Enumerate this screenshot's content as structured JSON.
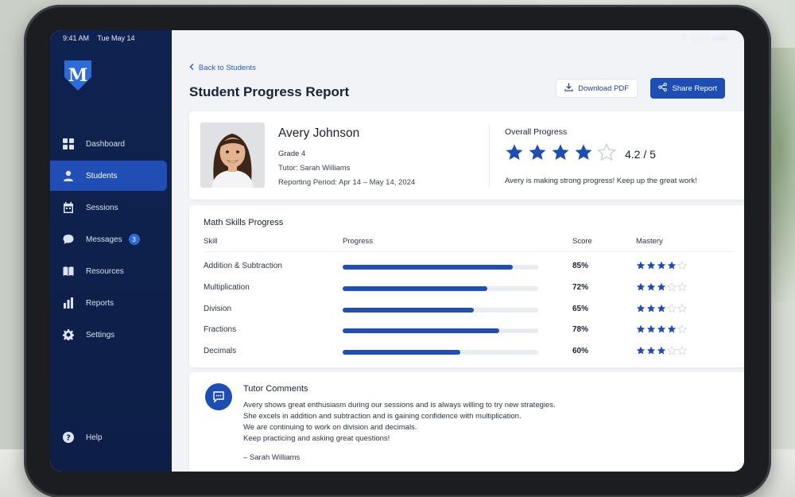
{
  "status": {
    "time": "9:41 AM",
    "date": "Tue May 14",
    "battery": "100%"
  },
  "sidebar": {
    "logo_letter": "M",
    "items": [
      {
        "label": "Dashboard",
        "icon": "grid-icon"
      },
      {
        "label": "Students",
        "icon": "person-icon",
        "active": true
      },
      {
        "label": "Sessions",
        "icon": "calendar-icon"
      },
      {
        "label": "Messages",
        "icon": "chat-icon",
        "badge": "3"
      },
      {
        "label": "Resources",
        "icon": "book-icon"
      },
      {
        "label": "Reports",
        "icon": "bar-chart-icon"
      },
      {
        "label": "Settings",
        "icon": "gear-icon"
      }
    ],
    "help_label": "Help"
  },
  "header": {
    "back_label": "Back to Students",
    "title": "Student Progress Report",
    "download_label": "Download PDF",
    "share_label": "Share Report"
  },
  "student": {
    "name": "Avery Johnson",
    "grade": "Grade 4",
    "tutor": "Tutor: Sarah Williams",
    "period": "Reporting Period: Apr 14 – May 14, 2024"
  },
  "overall": {
    "title": "Overall Progress",
    "rating": 4.2,
    "score_text": "4.2 / 5",
    "stars_filled": 4,
    "stars_total": 5,
    "message": "Avery is making strong progress! Keep up the great work!"
  },
  "skills": {
    "title": "Math Skills Progress",
    "columns": [
      "Skill",
      "Progress",
      "Score",
      "Mastery"
    ],
    "rows": [
      {
        "skill": "Addition & Subtraction",
        "progress": 0.87,
        "score": "85%",
        "mastery": 4
      },
      {
        "skill": "Multiplication",
        "progress": 0.74,
        "score": "72%",
        "mastery": 3
      },
      {
        "skill": "Division",
        "progress": 0.67,
        "score": "65%",
        "mastery": 3
      },
      {
        "skill": "Fractions",
        "progress": 0.8,
        "score": "78%",
        "mastery": 4
      },
      {
        "skill": "Decimals",
        "progress": 0.6,
        "score": "60%",
        "mastery": 3
      }
    ],
    "mastery_total": 5
  },
  "comments": {
    "title": "Tutor Comments",
    "lines": [
      "Avery shows great enthusiasm during our sessions and is always willing to try new strategies.",
      "She excels in addition and subtraction and is gaining confidence with multiplication.",
      "We are continuing to work on division and decimals.",
      "Keep practicing and asking great questions!"
    ],
    "signature": "– Sarah Williams"
  },
  "colors": {
    "accent": "#1e4db4",
    "sidebar": "#0f2350",
    "star_empty": "#c9cfd9"
  }
}
